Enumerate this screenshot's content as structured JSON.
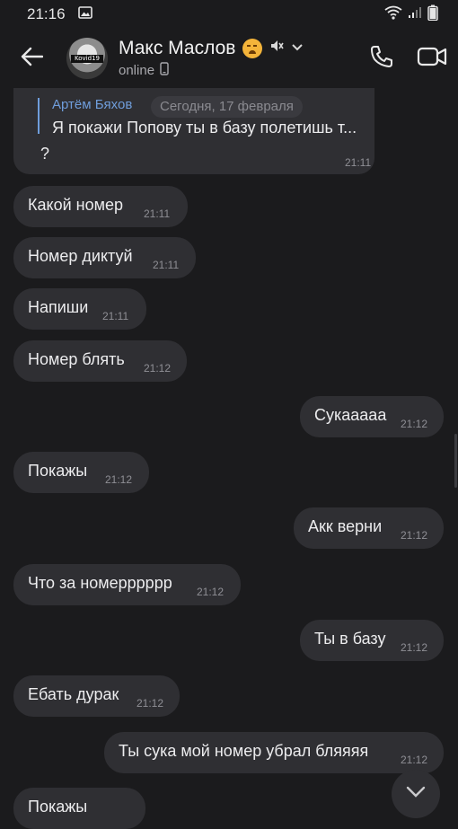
{
  "status_bar": {
    "time": "21:16"
  },
  "header": {
    "contact_name": "Макс Маслов",
    "avatar_tag": "Kovid19",
    "status": "online"
  },
  "reply": {
    "author": "Артём Бяхов",
    "quote": "Я покажи Попову ты в базу полетишь т...",
    "text": "?",
    "time": "21:11"
  },
  "date_chip": "Сегодня, 17 февраля",
  "messages": [
    {
      "text": "Какой номер",
      "time": "21:11",
      "direction": "incoming"
    },
    {
      "text": "Номер диктуй",
      "time": "21:11",
      "direction": "incoming"
    },
    {
      "text": "Напиши",
      "time": "21:11",
      "direction": "incoming"
    },
    {
      "text": "Номер блять",
      "time": "21:12",
      "direction": "incoming"
    },
    {
      "text": "Сукааааа",
      "time": "21:12",
      "direction": "outgoing"
    },
    {
      "text": "Покажы",
      "time": "21:12",
      "direction": "incoming"
    },
    {
      "text": "Акк верни",
      "time": "21:12",
      "direction": "outgoing"
    },
    {
      "text": "Что за номерррррр",
      "time": "21:12",
      "direction": "incoming"
    },
    {
      "text": "Ты в базу",
      "time": "21:12",
      "direction": "outgoing"
    },
    {
      "text": "Ебать дурак",
      "time": "21:12",
      "direction": "incoming"
    },
    {
      "text": "Ты сука мой номер убрал бляяяя",
      "time": "21:12",
      "direction": "outgoing"
    },
    {
      "text": "Покажы",
      "time": "",
      "direction": "incoming"
    }
  ]
}
